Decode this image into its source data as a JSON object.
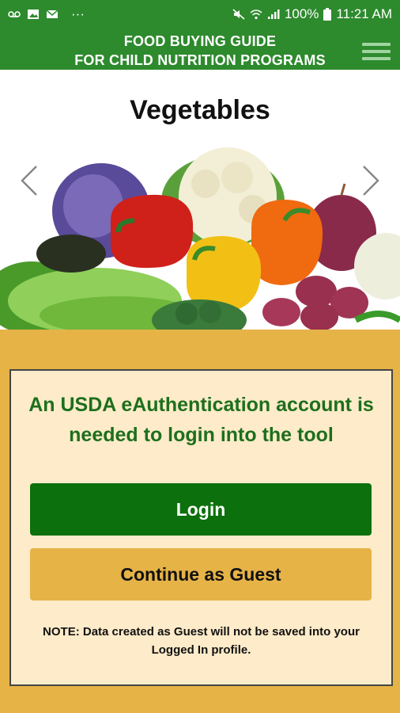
{
  "status_bar": {
    "battery": "100%",
    "time": "11:21 AM",
    "more": "···"
  },
  "app_bar": {
    "title_line1": "FOOD BUYING GUIDE",
    "title_line2": "FOR CHILD NUTRITION PROGRAMS"
  },
  "carousel": {
    "title": "Vegetables"
  },
  "login_panel": {
    "message": "An USDA eAuthentication account is needed to login into the tool",
    "login_label": "Login",
    "guest_label": "Continue as Guest",
    "note": "NOTE: Data created as Guest will not be saved into your Logged In profile."
  },
  "colors": {
    "header_green": "#2d8a2d",
    "button_green": "#0c700c",
    "gold": "#e6b347",
    "panel_bg": "#fdebc9",
    "message_green": "#1d6f1d"
  }
}
